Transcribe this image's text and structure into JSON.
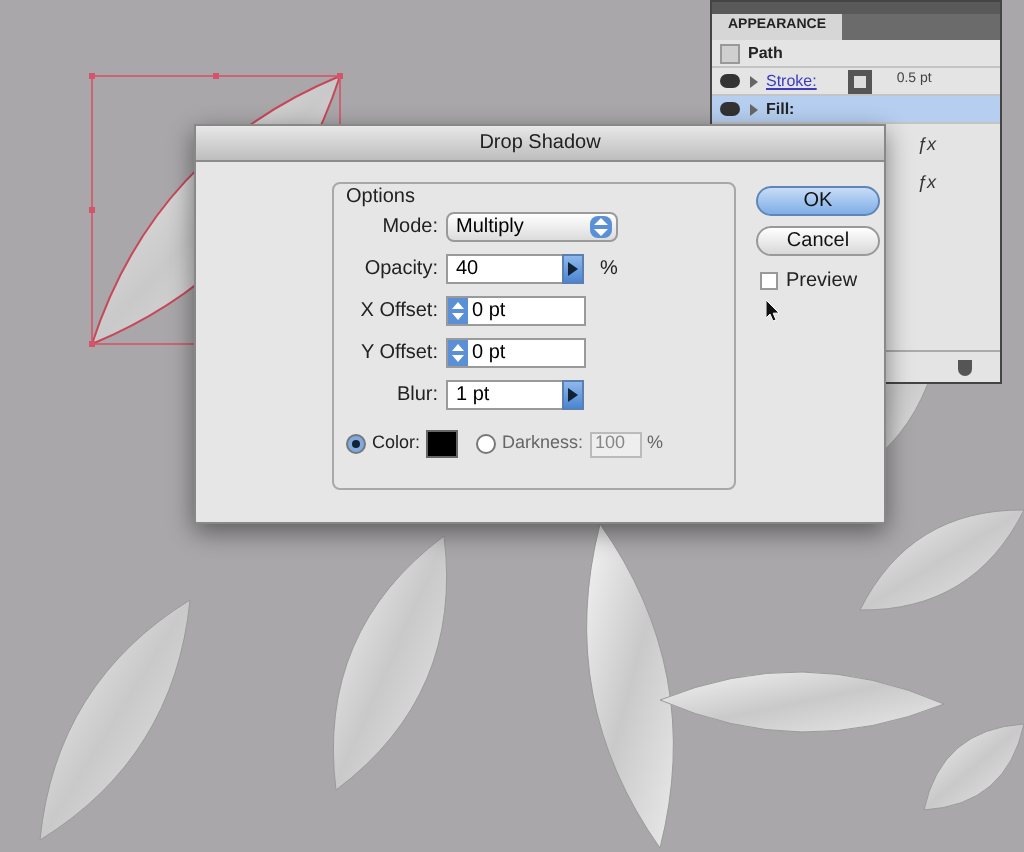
{
  "appearance_panel": {
    "title": "APPEARANCE",
    "rows": [
      {
        "kind": "path",
        "label": "Path",
        "selected": false
      },
      {
        "kind": "stroke",
        "label": "Stroke:",
        "value": "0.5 pt",
        "selected": false
      },
      {
        "kind": "fill",
        "label": "Fill:",
        "selected": true
      }
    ],
    "effect_marks": [
      "ƒx",
      "ƒx"
    ]
  },
  "dialog": {
    "title": "Drop Shadow",
    "group_title": "Options",
    "fields": [
      {
        "kind": "select",
        "label": "Mode:",
        "value": "Multiply"
      },
      {
        "kind": "combo",
        "label": "Opacity:",
        "value": "40",
        "unit": "%"
      },
      {
        "kind": "stepper",
        "label": "X Offset:",
        "value": "0 pt"
      },
      {
        "kind": "stepper",
        "label": "Y Offset:",
        "value": "0 pt"
      },
      {
        "kind": "combo",
        "label": "Blur:",
        "value": "1 pt"
      }
    ],
    "shadow_source": [
      {
        "kind": "color",
        "label": "Color:",
        "selected": true
      },
      {
        "kind": "darkness",
        "label": "Darkness:",
        "value": "100",
        "unit": "%",
        "selected": false,
        "disabled": true
      }
    ],
    "buttons": [
      {
        "label": "OK",
        "default": true
      },
      {
        "label": "Cancel",
        "default": false
      }
    ],
    "preview": {
      "label": "Preview",
      "checked": false
    }
  }
}
